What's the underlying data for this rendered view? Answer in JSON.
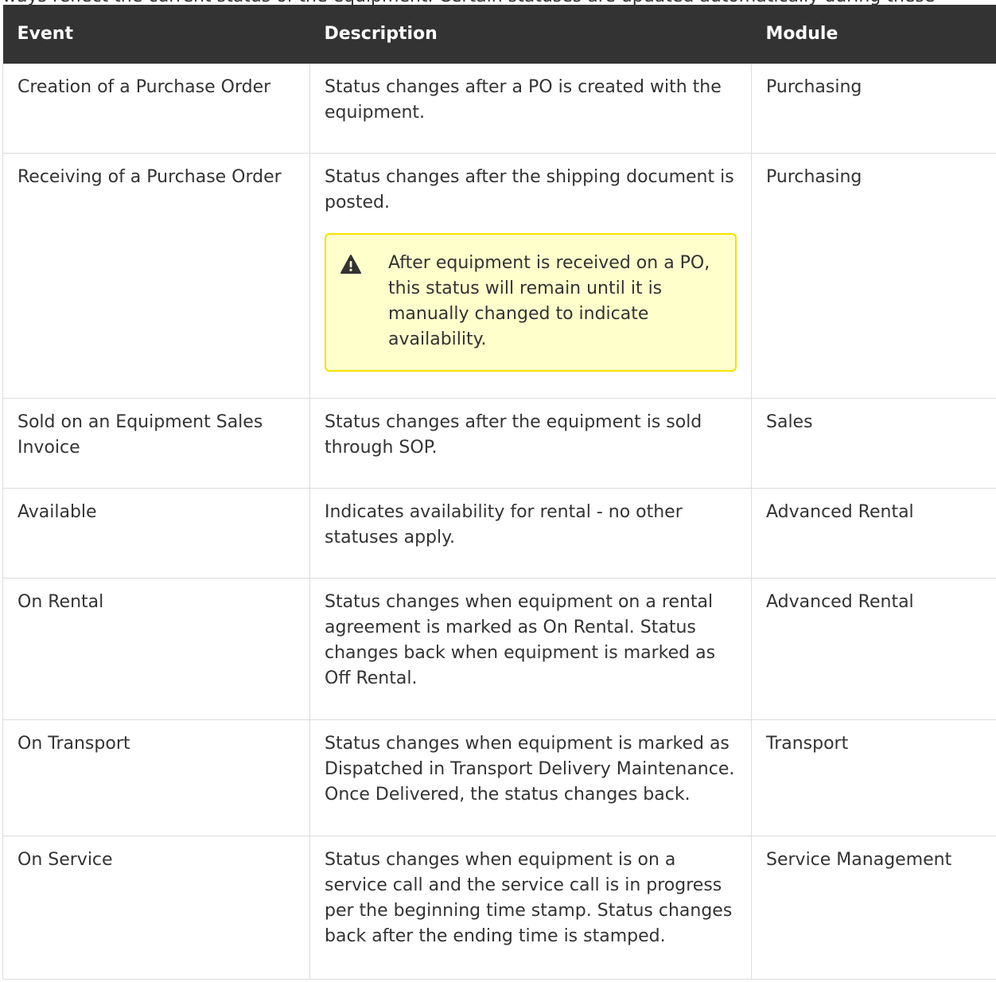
{
  "clipped_text": "ways reflect the current status of the equipment. Certain statuses are updated automatically during these",
  "table": {
    "headers": [
      "Event",
      "Description",
      "Module"
    ],
    "rows": [
      {
        "event": "Creation of a Purchase Order",
        "description": "Status changes after a PO is created with the equipment.",
        "module": "Purchasing"
      },
      {
        "event": "Receiving of a Purchase Order",
        "description": "Status changes after the shipping document is posted.",
        "module": "Purchasing",
        "warning": "After equipment is received on a PO, this status will remain until it is manually changed to indicate availability."
      },
      {
        "event": "Sold on an Equipment Sales Invoice",
        "description": "Status changes after the equipment is sold through SOP.",
        "module": "Sales"
      },
      {
        "event": "Available",
        "description": "Indicates availability for rental - no other statuses apply.",
        "module": "Advanced Rental"
      },
      {
        "event": "On Rental",
        "description": "Status changes when equipment on a rental agreement is marked as On Rental. Status changes back when equipment is marked as Off Rental.",
        "module": "Advanced Rental"
      },
      {
        "event": "On Transport",
        "description": "Status changes when equipment is marked as Dispatched in Transport Delivery Maintenance. Once Delivered, the status changes back.",
        "module": "Transport"
      },
      {
        "event": "On Service",
        "description": "Status changes when equipment is on a service call and the service call is in progress per the beginning time stamp. Status changes back after the ending time is stamped.",
        "module": "Service Management"
      }
    ]
  },
  "icons": {
    "warning": "warning-triangle-icon"
  },
  "colors": {
    "header_bg": "#333333",
    "warning_bg": "#ffffcc",
    "warning_border": "#f5e100"
  }
}
